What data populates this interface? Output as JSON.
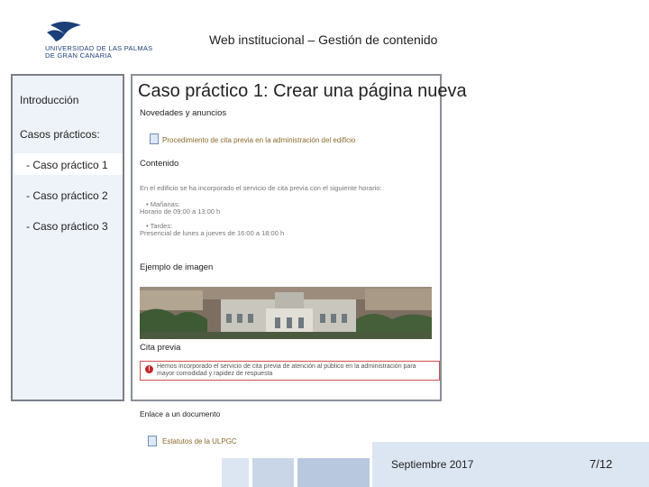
{
  "header": {
    "logo_lines": [
      "UNIVERSIDAD DE LAS PALMAS",
      "DE GRAN CANARIA"
    ],
    "title": "Web institucional – Gestión de contenido"
  },
  "sidebar": {
    "intro": "Introducción",
    "cases_heading": "Casos prácticos:",
    "items": [
      {
        "label": "- Caso práctico 1",
        "active": true
      },
      {
        "label": "- Caso práctico 2",
        "active": false
      },
      {
        "label": "- Caso práctico 3",
        "active": false
      }
    ]
  },
  "main": {
    "title": "Caso práctico 1: Crear una página nueva",
    "screenshot": {
      "news_heading": "Novedades y anuncios",
      "news_link": "Procedimiento de cita previa en la administración del edificio",
      "content_heading": "Contenido",
      "content_intro": "En el edificio se ha incorporado el servicio de cita previa con el siguiente horario:",
      "morning_label": "Mañanas:",
      "morning_text": "Horario de 09:00 a 13:00 h",
      "afternoon_label": "Tardes:",
      "afternoon_text": "Presencial de lunes a jueves de 16:00 a 18:00 h",
      "image_heading": "Ejemplo de imagen",
      "appointment_heading": "Cita previa",
      "alert_text": "Hemos incorporado el servicio de cita previa de atención al público en la administración para mayor comodidad y rapidez de respuesta",
      "link_heading": "Enlace a un documento",
      "doc_link": "Estatutos de la ULPGC"
    }
  },
  "footer": {
    "date": "Septiembre 2017",
    "page": "7/12"
  },
  "colors": {
    "brand": "#1c3f7a",
    "sidebar_bg": "#eef3f9",
    "footer_light": "#dce6f2",
    "footer_mid": "#c9d6e8",
    "footer_dark": "#b8c8df"
  }
}
